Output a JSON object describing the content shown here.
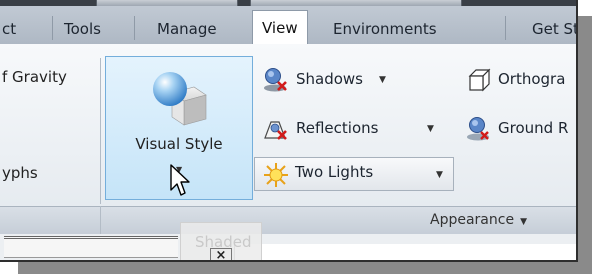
{
  "tabs": [
    {
      "label": "ct"
    },
    {
      "label": "Tools"
    },
    {
      "label": "Manage"
    },
    {
      "label": "View",
      "active": true
    },
    {
      "label": "Environments"
    },
    {
      "label": "Get St"
    }
  ],
  "left_panel": {
    "gravity_label": "f Gravity",
    "glyphs_label": "yphs"
  },
  "visual_style": {
    "label": "Visual Style",
    "dropdown_glyph": "▼"
  },
  "appearance_items": {
    "shadows": {
      "label": "Shadows",
      "icon": "shadows-icon"
    },
    "reflections": {
      "label": "Reflections",
      "icon": "reflections-icon"
    },
    "lighting": {
      "label": "Two Lights",
      "icon": "lights-icon"
    },
    "orthographic": {
      "label": "Orthogra",
      "icon": "orthographic-cube-icon"
    },
    "ground": {
      "label": "Ground R",
      "icon": "ground-reflection-icon"
    }
  },
  "caret_glyph": "▼",
  "panel": {
    "label": "Appearance"
  },
  "viewport": {
    "close_label": "×",
    "shaded_label": "Shaded"
  },
  "colors": {
    "selected_button_bg": "#c5e4f8",
    "selected_button_border": "#74aedb",
    "ribbon_bg": "#eef2f6",
    "tab_bar_bg": "#b8c2ce"
  }
}
